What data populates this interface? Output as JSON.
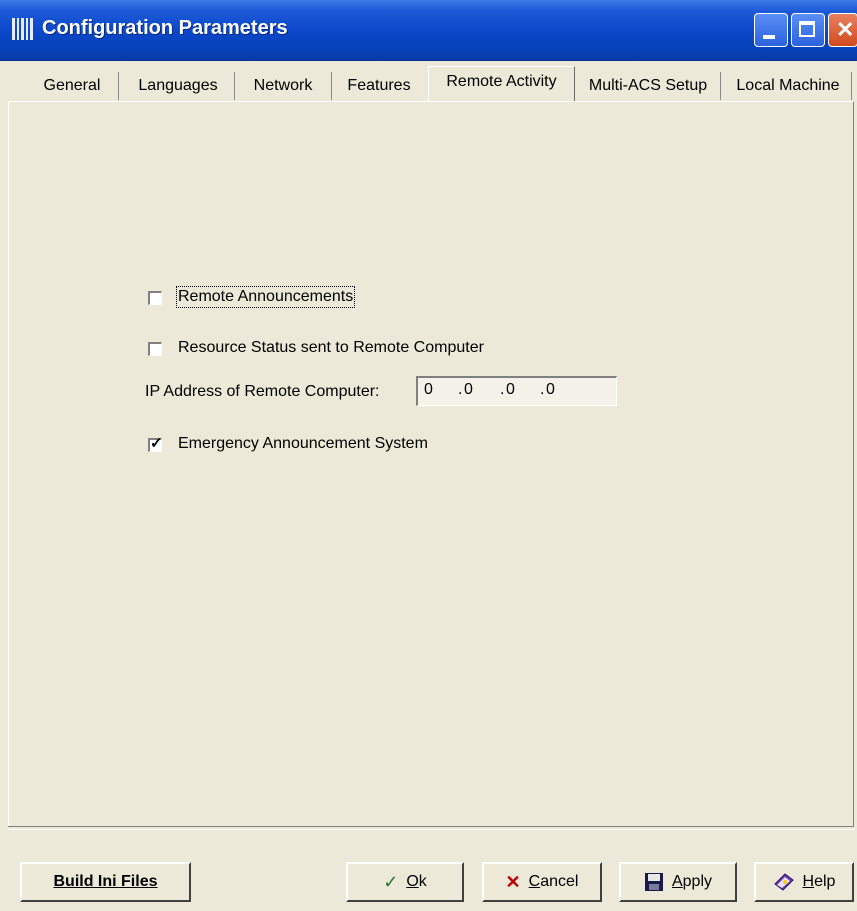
{
  "window": {
    "title": "Configuration Parameters",
    "controls": [
      "minimize",
      "maximize",
      "close"
    ]
  },
  "tabs": [
    {
      "label": "General",
      "active": false
    },
    {
      "label": "Languages",
      "active": false
    },
    {
      "label": "Network",
      "active": false
    },
    {
      "label": "Features",
      "active": false
    },
    {
      "label": "Remote Activity",
      "active": true
    },
    {
      "label": "Multi-ACS Setup",
      "active": false
    },
    {
      "label": "Local Machine",
      "active": false
    }
  ],
  "remote_activity": {
    "remote_announcements": {
      "label": "Remote Announcements",
      "checked": false
    },
    "resource_status": {
      "label": "Resource Status sent to Remote Computer",
      "checked": false
    },
    "ip_address": {
      "label": "IP Address of Remote Computer:",
      "octets": [
        "0",
        "0",
        "0",
        "0"
      ]
    },
    "emergency_system": {
      "label": "Emergency Announcement System",
      "checked": true
    }
  },
  "buttons": {
    "build_ini": "Build Ini Files",
    "ok_rest": "k",
    "ok_accel": "O",
    "cancel_accel": "C",
    "cancel_rest": "ancel",
    "apply_accel": "A",
    "apply_rest": "pply",
    "help_accel": "H",
    "help_rest": "elp"
  },
  "icons": {
    "ok": "checkmark-icon",
    "cancel": "x-icon",
    "apply": "floppy-disk-icon",
    "help": "help-book-icon"
  },
  "colors": {
    "titlebar": "#0a46c8",
    "dialog_bg": "#ece9d8",
    "cancel_x": "#c00000"
  }
}
